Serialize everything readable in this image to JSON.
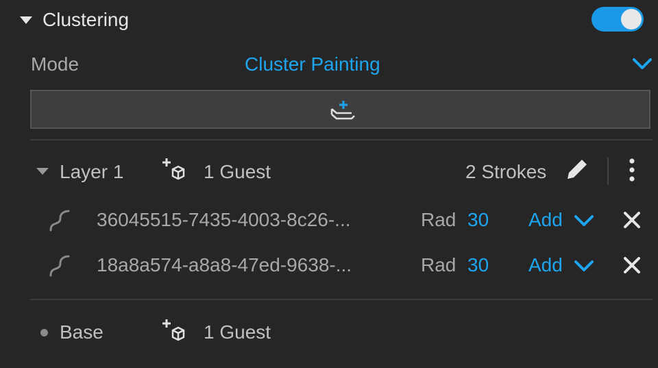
{
  "section": {
    "title": "Clustering",
    "enabled": true
  },
  "mode": {
    "label": "Mode",
    "value": "Cluster Painting"
  },
  "layers": [
    {
      "name": "Layer 1",
      "guests": "1 Guest",
      "strokes": "2 Strokes",
      "items": [
        {
          "id": "36045515-7435-4003-8c26-...",
          "rad_label": "Rad",
          "rad_value": "30",
          "action": "Add"
        },
        {
          "id": "18a8a574-a8a8-47ed-9638-...",
          "rad_label": "Rad",
          "rad_value": "30",
          "action": "Add"
        }
      ]
    },
    {
      "name": "Base",
      "guests": "1 Guest"
    }
  ],
  "colors": {
    "accent": "#1ea5f0",
    "background": "#262626"
  },
  "icons": [
    "caret-down-icon",
    "toggle-switch",
    "chevron-down-icon",
    "add-layer-icon",
    "add-guest-icon",
    "pencil-icon",
    "more-vertical-icon",
    "stroke-curve-icon",
    "close-icon",
    "bullet-icon"
  ]
}
